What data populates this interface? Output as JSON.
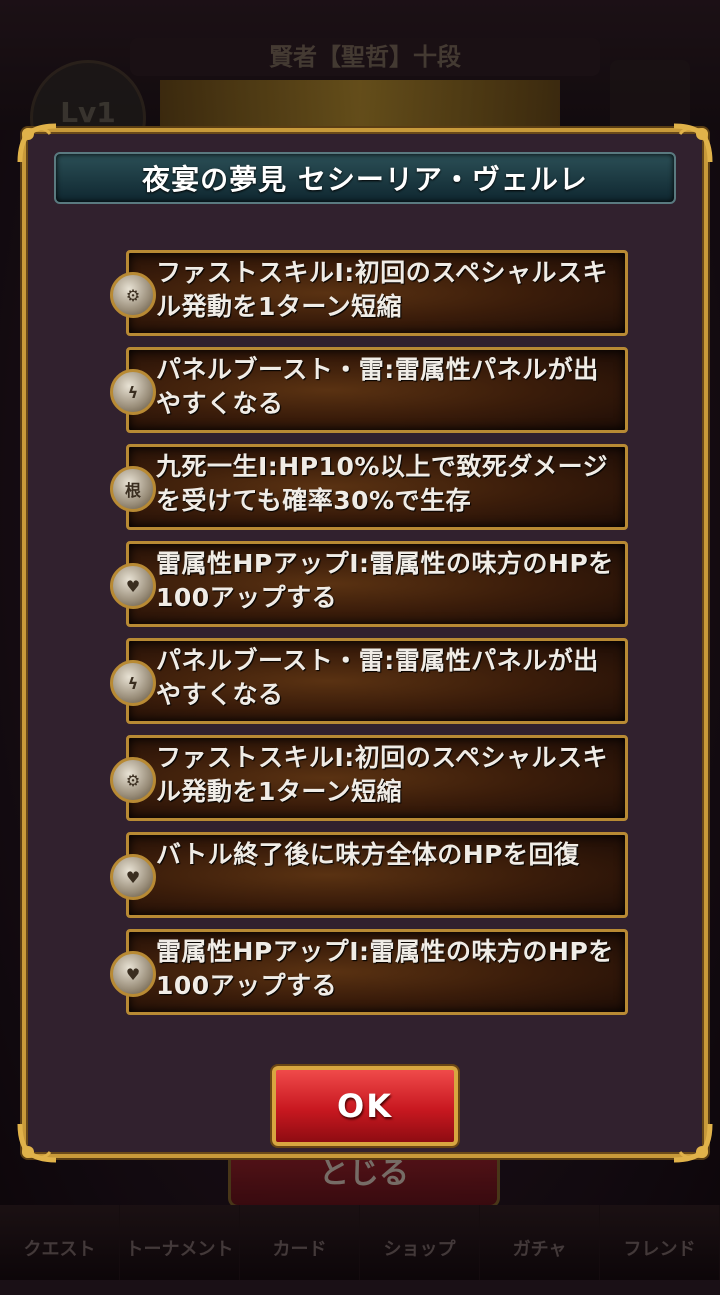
{
  "background": {
    "rank_text": "賢者【聖哲】十段",
    "level_text": "Lv1",
    "close_label": "とじる",
    "nav": [
      "クエスト",
      "トーナメント",
      "カード",
      "ショップ",
      "ガチャ",
      "フレンド"
    ]
  },
  "dialog": {
    "title": "夜宴の夢見 セシーリア・ヴェルレ",
    "skills": [
      {
        "text": "ファストスキルI:初回のスペシャルスキル発動を1ターン短縮",
        "icon": "gear-icon"
      },
      {
        "text": "パネルブースト・雷:雷属性パネルが出やすくなる",
        "icon": "lightning-icon"
      },
      {
        "text": "九死一生I:HP10%以上で致死ダメージを受けても確率30%で生存",
        "icon": "root-icon",
        "glyph": "根"
      },
      {
        "text": "雷属性HPアップI:雷属性の味方のHPを100アップする",
        "icon": "heart-up-icon"
      },
      {
        "text": "パネルブースト・雷:雷属性パネルが出やすくなる",
        "icon": "lightning-icon"
      },
      {
        "text": "ファストスキルI:初回のスペシャルスキル発動を1ターン短縮",
        "icon": "gear-icon"
      },
      {
        "text": "バトル終了後に味方全体のHPを回復",
        "icon": "heart-plus-icon"
      },
      {
        "text": "雷属性HPアップI:雷属性の味方のHPを100アップする",
        "icon": "heart-up-icon"
      }
    ],
    "ok_label": "OK"
  },
  "colors": {
    "frame_gold": "#c89a3a",
    "dialog_bg": "#31212e",
    "title_bar": "#0f2730",
    "ok_red": "#c81820"
  }
}
